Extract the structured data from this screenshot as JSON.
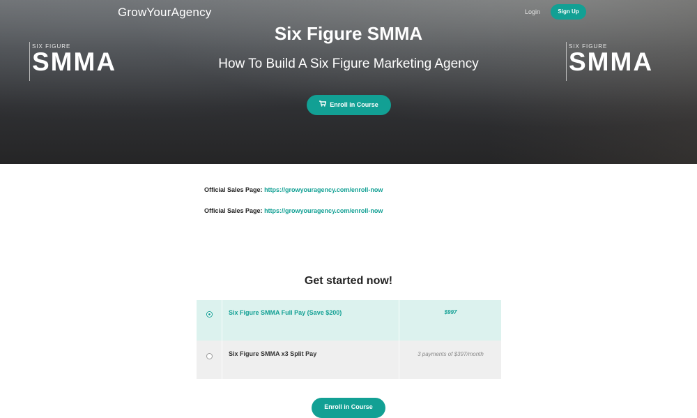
{
  "header": {
    "brand": "GrowYourAgency",
    "login_label": "Login",
    "signup_label": "Sign Up"
  },
  "hero": {
    "title": "Six Figure SMMA",
    "subtitle": "How To Build A Six Figure Marketing Agency",
    "enroll_label": "Enroll in Course",
    "cart_icon": "shopping-cart-icon",
    "logo": {
      "small_text": "SIX FIGURE",
      "big_text": "SMMA"
    }
  },
  "content": {
    "sales_lines": [
      {
        "label": "Official Sales Page:",
        "url": "https://growyouragency.com/enroll-now"
      },
      {
        "label": "Official Sales Page:",
        "url": "https://growyouragency.com/enroll-now"
      }
    ]
  },
  "pricing": {
    "heading": "Get started now!",
    "plans": [
      {
        "name": "Six Figure SMMA Full Pay (Save $200)",
        "price": "$997",
        "selected": true
      },
      {
        "name": "Six Figure SMMA x3 Split Pay",
        "price": "3 payments of $397/month",
        "selected": false
      }
    ],
    "enroll_label": "Enroll in Course"
  },
  "colors": {
    "accent": "#12a094",
    "selected_row_bg": "#dcf2ee",
    "unselected_row_bg": "#efefef"
  }
}
